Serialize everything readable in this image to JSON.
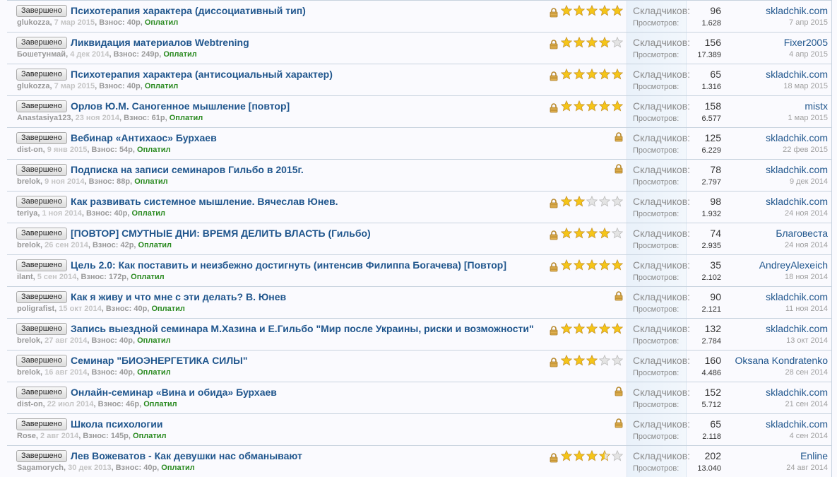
{
  "labels": {
    "button": "Завершено",
    "participants": "Складчиков:",
    "views": "Просмотров:",
    "fee": "Взнос:",
    "paid": "Оплатил"
  },
  "colors": {
    "title": "#20568d",
    "paid": "#2a8a20",
    "star": "#f5c518"
  },
  "rows": [
    {
      "title": "Психотерапия характера (диссоциативный тип)",
      "author": "glukozza",
      "date": "7 мар 2015",
      "fee": "40р",
      "rating": 5,
      "participants": "96",
      "views": "1.628",
      "last_user": "skladchik.com",
      "last_date": "7 апр 2015"
    },
    {
      "title": "Ликвидация материалов Webtrening",
      "author": "Бошетунмай",
      "date": "4 дек 2014",
      "fee": "249р",
      "rating": 4,
      "participants": "156",
      "views": "17.389",
      "last_user": "Fixer2005",
      "last_date": "4 апр 2015"
    },
    {
      "title": "Психотерапия характера (антисоциальный характер)",
      "author": "glukozza",
      "date": "7 мар 2015",
      "fee": "40р",
      "rating": 5,
      "participants": "65",
      "views": "1.316",
      "last_user": "skladchik.com",
      "last_date": "18 мар 2015"
    },
    {
      "title": "Орлов Ю.М. Саногенное мышление [повтор]",
      "author": "Anastasiya123",
      "date": "23 ноя 2014",
      "fee": "61р",
      "rating": 5,
      "participants": "158",
      "views": "6.577",
      "last_user": "mistx",
      "last_date": "1 мар 2015"
    },
    {
      "title": "Вебинар «Антихаос» Бурхаев",
      "author": "dist-on",
      "date": "9 янв 2015",
      "fee": "54р",
      "rating": 0,
      "participants": "125",
      "views": "6.229",
      "last_user": "skladchik.com",
      "last_date": "22 фев 2015"
    },
    {
      "title": "Подписка на записи семинаров Гильбо в 2015г.",
      "author": "brelok",
      "date": "9 ноя 2014",
      "fee": "88р",
      "rating": 0,
      "participants": "78",
      "views": "2.797",
      "last_user": "skladchik.com",
      "last_date": "9 дек 2014"
    },
    {
      "title": "Как развивать системное мышление. Вячеслав Юнев.",
      "author": "teriya",
      "date": "1 ноя 2014",
      "fee": "40р",
      "rating": 2,
      "participants": "98",
      "views": "1.932",
      "last_user": "skladchik.com",
      "last_date": "24 ноя 2014"
    },
    {
      "title": "[ПОВТОР] СМУТНЫЕ ДНИ: ВРЕМЯ ДЕЛИТЬ ВЛАСТЬ (Гильбо)",
      "author": "brelok",
      "date": "26 сен 2014",
      "fee": "42р",
      "rating": 4,
      "participants": "74",
      "views": "2.935",
      "last_user": "Благовеста",
      "last_date": "24 ноя 2014"
    },
    {
      "title": "Цель 2.0: Как поставить и неизбежно достигнуть (интенсив Филиппа Богачева) [Повтор]",
      "author": "ilant",
      "date": "5 сен 2014",
      "fee": "172р",
      "rating": 5,
      "participants": "35",
      "views": "2.102",
      "last_user": "AndreyAlexeich",
      "last_date": "18 ноя 2014"
    },
    {
      "title": "Как я живу и что мне с эти делать? В. Юнев",
      "author": "poligrafist",
      "date": "15 окт 2014",
      "fee": "40р",
      "rating": 0,
      "participants": "90",
      "views": "2.121",
      "last_user": "skladchik.com",
      "last_date": "11 ноя 2014"
    },
    {
      "title": "Запись выездной семинара М.Хазина и Е.Гильбо \"Мир после Украины, риски и возможности\"",
      "author": "brelok",
      "date": "27 авг 2014",
      "fee": "40р",
      "rating": 5,
      "participants": "132",
      "views": "2.784",
      "last_user": "skladchik.com",
      "last_date": "13 окт 2014"
    },
    {
      "title": "Семинар \"БИОЭНЕРГЕТИКА СИЛЫ\"",
      "author": "brelok",
      "date": "16 авг 2014",
      "fee": "40р",
      "rating": 3,
      "participants": "160",
      "views": "4.486",
      "last_user": "Oksana Kondratenko",
      "last_date": "28 сен 2014"
    },
    {
      "title": "Онлайн-семинар «Вина и обида» Бурхаев",
      "author": "dist-on",
      "date": "22 июл 2014",
      "fee": "46р",
      "rating": 0,
      "participants": "152",
      "views": "5.712",
      "last_user": "skladchik.com",
      "last_date": "21 сен 2014"
    },
    {
      "title": "Школа психологии",
      "author": "Rose",
      "date": "2 авг 2014",
      "fee": "145р",
      "rating": 0,
      "participants": "65",
      "views": "2.118",
      "last_user": "skladchik.com",
      "last_date": "4 сен 2014"
    },
    {
      "title": "Лев Вожеватов - Как девушки нас обманывают",
      "author": "Sagamorych",
      "date": "30 дек 2013",
      "fee": "40р",
      "rating": 3.5,
      "participants": "202",
      "views": "13.040",
      "last_user": "Enline",
      "last_date": "24 авг 2014"
    }
  ]
}
